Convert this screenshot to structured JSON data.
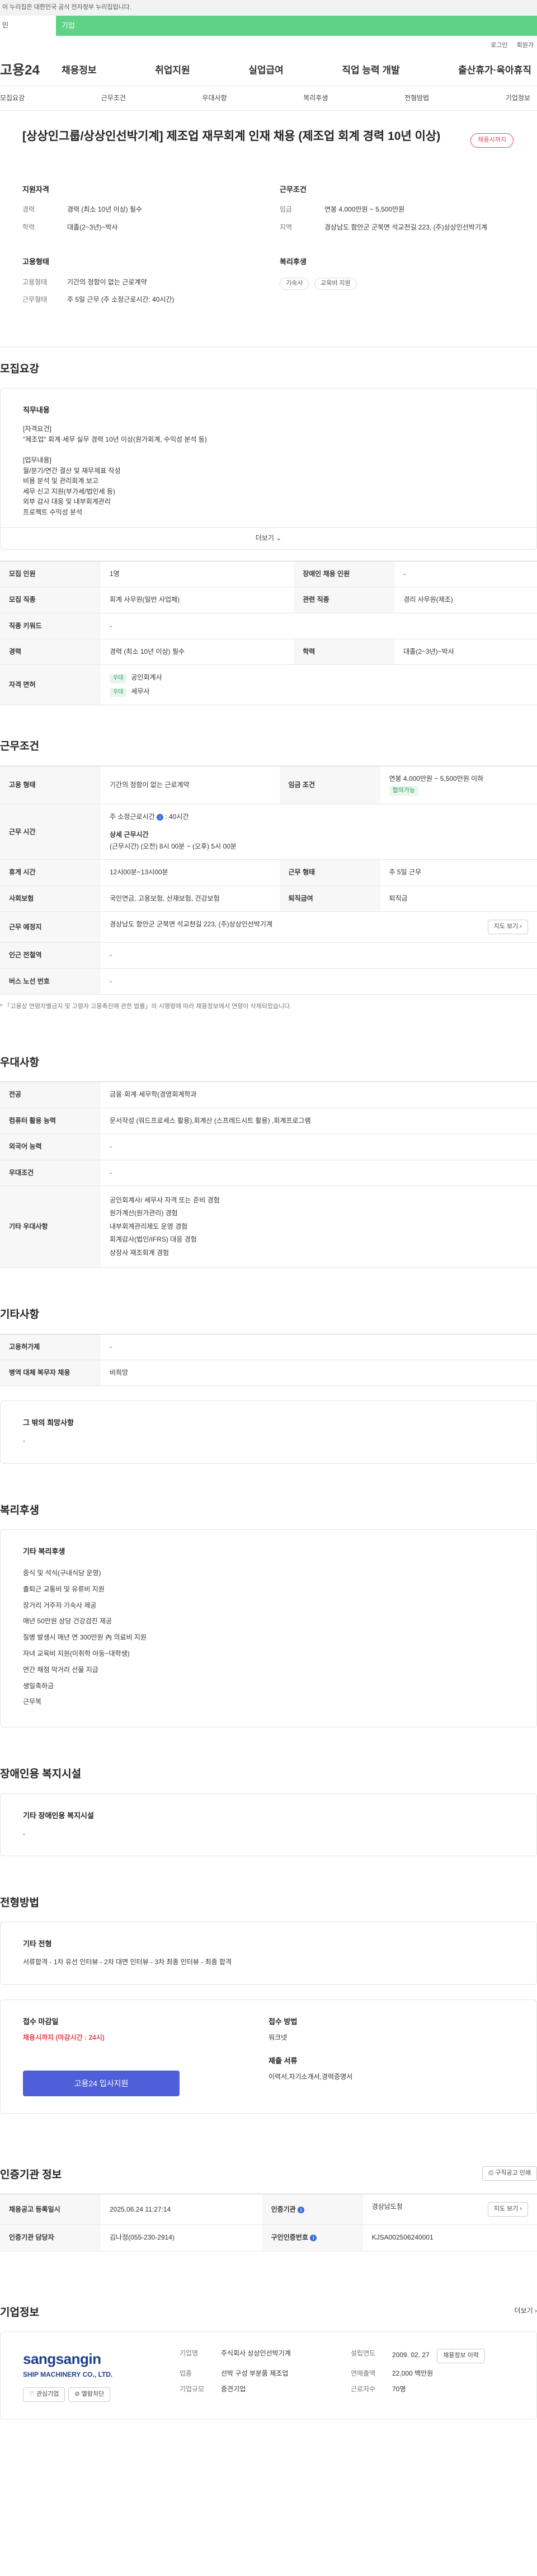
{
  "gov_notice": "이 누리집은 대한민국 공식 전자정부 누리집입니다.",
  "top_tabs": {
    "left": "인",
    "main": "기업"
  },
  "util": {
    "login": "로그인",
    "join": "회원가"
  },
  "logo": "고용24",
  "gnb": [
    "채용정보",
    "취업지원",
    "실업급여",
    "직업 능력 개발",
    "출산휴가·육아휴직"
  ],
  "sub_nav": [
    "모집요강",
    "근무조건",
    "우대사항",
    "복리후생",
    "전형방법",
    "기업정보"
  ],
  "job": {
    "title": "[상상인그룹/상상인선박기계] 제조업 재무회계 인재 채용 (제조업 회계 경력 10년 이상)",
    "badge": "채용시까지",
    "qual_head": "지원자격",
    "career_k": "경력",
    "career_v": "경력 (최소 10년 이상) 필수",
    "edu_k": "학력",
    "edu_v": "대졸(2~3년)~박사",
    "emp_head": "고용형태",
    "type_k": "고용형태",
    "type_v": "기간의 정함이 없는 근로계약",
    "hours_k": "근무형태",
    "hours_v": "주 5일 근무 (주 소정근로시간: 40시간)",
    "work_head": "근무조건",
    "wage_k": "임금",
    "wage_v": "연봉 4,000만원 ~ 5,500만원",
    "loc_k": "지역",
    "loc_v": "경상남도 함안군 군북면 석교천길 223, (주)상상인선박기계",
    "welfare_head": "복리후생",
    "welfare_chips": [
      "기숙사",
      "교육비 지원"
    ]
  },
  "recruit": {
    "section_title": "모집요강",
    "duty_head": "직무내용",
    "duty_text": "[자격요건]\n\"제조업\" 회계·세무 실무 경력 10년 이상(원가회계, 수익성 분석 등)\n\n[업무내용]\n월/분기/연간 결산 및 재무제표 작성\n비용 분석 및 관리회계 보고\n세무 신고 지원(부가세/법인세 등)\n외부 감사 대응 및 내부회계관리\n프로젝트 수익성 분석",
    "more": "더보기",
    "rows": [
      {
        "k1": "모집 인원",
        "v1": "1명",
        "k2": "장애인 채용 인원",
        "v2": "-"
      },
      {
        "k1": "모집 직종",
        "v1": "회계 사무원(일반 사업체)",
        "k2": "관련 직종",
        "v2": "경리 사무원(제조)"
      },
      {
        "k1": "직종 키워드",
        "v1": "-",
        "k2": "",
        "v2": ""
      },
      {
        "k1": "경력",
        "v1": "경력 (최소 10년 이상) 필수",
        "k2": "학력",
        "v2": "대졸(2~3년)~박사"
      }
    ],
    "license_k": "자격 면허",
    "licenses": [
      {
        "tag": "우대",
        "name": "공인회계사"
      },
      {
        "tag": "우대",
        "name": "세무사"
      }
    ]
  },
  "work": {
    "section_title": "근무조건",
    "type_k": "고용 형태",
    "type_v": "기간의 정함이 없는 근로계약",
    "wage_k": "임금 조건",
    "wage_v": "연봉 4,000만원 ~ 5,500만원 이하",
    "wage_tag": "협의가능",
    "time_k": "근무 시간",
    "time_week": "주 소정근로시간",
    "time_week_v": "40시간",
    "time_detail_head": "상세 근무시간",
    "time_detail": "(근무시간) (오전) 8시 00분 ~ (오후) 5시 00분",
    "break_k": "휴게 시간",
    "break_v": "12시00분~13시00분",
    "shape_k": "근무 형태",
    "shape_v": "주 5일 근무",
    "insurance_k": "사회보험",
    "insurance_v": "국민연금, 고용보험, 산재보험, 건강보험",
    "retire_k": "퇴직급여",
    "retire_v": "퇴직금",
    "place_k": "근무 예정지",
    "place_v": "경상남도 함안군 군북면 석교천길 223, (주)상상인선박기계",
    "map_btn": "지도 보기",
    "station_k": "인근 전철역",
    "station_v": "-",
    "bus_k": "버스 노선 번호",
    "bus_v": "-",
    "note": "* 「고용상 연령차별금지 및 고령자 고용촉진에 관한 법률」의 시행령에 따라 채용정보에서 연령이 삭제되었습니다."
  },
  "pref": {
    "section_title": "우대사항",
    "rows": [
      {
        "k": "전공",
        "v": [
          "금융·회계·세무학(경영회계학과"
        ]
      },
      {
        "k": "컴퓨터 활용 능력",
        "v": [
          "문서작성 (워드프로세스 활용),회계산 (스프레드시트 활용) ,회계프로그램"
        ]
      },
      {
        "k": "외국어 능력",
        "v": [
          "-"
        ]
      },
      {
        "k": "우대조건",
        "v": [
          "-"
        ]
      },
      {
        "k": "기타 우대사항",
        "v": [
          "공인회계사/ 세무사 자격 또는 준비 경험",
          "원가계산(원가관리) 경험",
          "내부회계관리제도 운영 경험",
          "회계감사(법인/IFRS) 대응 경험",
          "상장사 재조회계 경험"
        ]
      }
    ]
  },
  "etc": {
    "section_title": "기타사항",
    "rows": [
      {
        "k": "고용허가제",
        "v": "-"
      },
      {
        "k": "병역 대체 복무자 채용",
        "v": "비희망"
      }
    ],
    "other_head": "그 밖의 희망사항",
    "other_v": "-"
  },
  "welfare": {
    "section_title": "복리후생",
    "head": "기타 복리후생",
    "items": [
      "중식 및 석식(구내식당 운영)",
      "출퇴근 교통비 및 유류비 지원",
      "장거리 거주자 기숙사 제공",
      "매년 50만원 상당 건강검진 제공",
      "질병 발생시 매년 연 300만원 內 의료비 지원",
      "자녀 교육비 지원(미취학 아동~대학생)",
      "연간 채점 막거리 선물 지급",
      "생일축하금",
      "근무복"
    ]
  },
  "disabled": {
    "section_title": "장애인용 복지시설",
    "head": "기타 장애인용 복지시설",
    "v": "-"
  },
  "process": {
    "section_title": "전형방법",
    "head": "기타 전형",
    "v": "서류합격 - 1차 유선 인터뷰 - 2차 대면 인터뷰 - 3차 최종 인터뷰 - 최종 합격",
    "deadline_head": "접수 마감일",
    "deadline_v": "채용시까지 (마감시간 : 24시)",
    "apply_btn": "고용24 입사지원",
    "method_head": "접수 방법",
    "method_v": "워크넷",
    "docs_head": "제출 서류",
    "docs_v": "이력서,자기소개서,경력증명서"
  },
  "agency": {
    "section_title": "인증기관 정보",
    "print_btn": "구직공고 인쇄",
    "reg_k": "채용공고 등록일시",
    "reg_v": "2025.06.24 11:27:14",
    "org_k": "인증기관",
    "org_v": "경상남도청",
    "map_btn": "지도 보기",
    "mgr_k": "인증기관 담당자",
    "mgr_v": "김나정(055-230-2914)",
    "num_k": "구인인증번호",
    "num_v": "KJSA002506240001"
  },
  "company": {
    "section_title": "기업정보",
    "more": "더보기",
    "logo_name": "sangsangin",
    "logo_sub": "SHIP MACHINERY CO., LTD.",
    "btn_interest": "관심기업",
    "btn_block": "열람차단",
    "name_k": "기업명",
    "name_v": "주식회사 상상인선박기계",
    "ind_k": "업종",
    "ind_v": "선박 구성 부분품 제조업",
    "size_k": "기업규모",
    "size_v": "중견기업",
    "est_k": "설립연도",
    "est_v": "2009. 02. 27",
    "sales_k": "연매출액",
    "sales_v": "22,000 백만원",
    "emp_k": "근로자수",
    "emp_v": "70명",
    "home_btn": "채용정보 이력"
  }
}
